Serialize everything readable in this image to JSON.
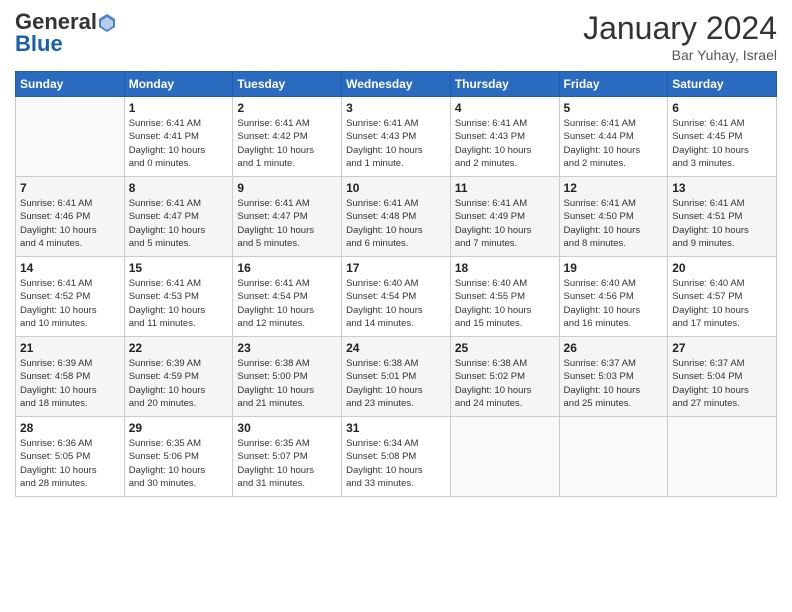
{
  "header": {
    "logo_general": "General",
    "logo_blue": "Blue",
    "month_title": "January 2024",
    "location": "Bar Yuhay, Israel"
  },
  "days_of_week": [
    "Sunday",
    "Monday",
    "Tuesday",
    "Wednesday",
    "Thursday",
    "Friday",
    "Saturday"
  ],
  "weeks": [
    [
      {
        "day": "",
        "info": ""
      },
      {
        "day": "1",
        "info": "Sunrise: 6:41 AM\nSunset: 4:41 PM\nDaylight: 10 hours\nand 0 minutes."
      },
      {
        "day": "2",
        "info": "Sunrise: 6:41 AM\nSunset: 4:42 PM\nDaylight: 10 hours\nand 1 minute."
      },
      {
        "day": "3",
        "info": "Sunrise: 6:41 AM\nSunset: 4:43 PM\nDaylight: 10 hours\nand 1 minute."
      },
      {
        "day": "4",
        "info": "Sunrise: 6:41 AM\nSunset: 4:43 PM\nDaylight: 10 hours\nand 2 minutes."
      },
      {
        "day": "5",
        "info": "Sunrise: 6:41 AM\nSunset: 4:44 PM\nDaylight: 10 hours\nand 2 minutes."
      },
      {
        "day": "6",
        "info": "Sunrise: 6:41 AM\nSunset: 4:45 PM\nDaylight: 10 hours\nand 3 minutes."
      }
    ],
    [
      {
        "day": "7",
        "info": "Sunrise: 6:41 AM\nSunset: 4:46 PM\nDaylight: 10 hours\nand 4 minutes."
      },
      {
        "day": "8",
        "info": "Sunrise: 6:41 AM\nSunset: 4:47 PM\nDaylight: 10 hours\nand 5 minutes."
      },
      {
        "day": "9",
        "info": "Sunrise: 6:41 AM\nSunset: 4:47 PM\nDaylight: 10 hours\nand 5 minutes."
      },
      {
        "day": "10",
        "info": "Sunrise: 6:41 AM\nSunset: 4:48 PM\nDaylight: 10 hours\nand 6 minutes."
      },
      {
        "day": "11",
        "info": "Sunrise: 6:41 AM\nSunset: 4:49 PM\nDaylight: 10 hours\nand 7 minutes."
      },
      {
        "day": "12",
        "info": "Sunrise: 6:41 AM\nSunset: 4:50 PM\nDaylight: 10 hours\nand 8 minutes."
      },
      {
        "day": "13",
        "info": "Sunrise: 6:41 AM\nSunset: 4:51 PM\nDaylight: 10 hours\nand 9 minutes."
      }
    ],
    [
      {
        "day": "14",
        "info": "Sunrise: 6:41 AM\nSunset: 4:52 PM\nDaylight: 10 hours\nand 10 minutes."
      },
      {
        "day": "15",
        "info": "Sunrise: 6:41 AM\nSunset: 4:53 PM\nDaylight: 10 hours\nand 11 minutes."
      },
      {
        "day": "16",
        "info": "Sunrise: 6:41 AM\nSunset: 4:54 PM\nDaylight: 10 hours\nand 12 minutes."
      },
      {
        "day": "17",
        "info": "Sunrise: 6:40 AM\nSunset: 4:54 PM\nDaylight: 10 hours\nand 14 minutes."
      },
      {
        "day": "18",
        "info": "Sunrise: 6:40 AM\nSunset: 4:55 PM\nDaylight: 10 hours\nand 15 minutes."
      },
      {
        "day": "19",
        "info": "Sunrise: 6:40 AM\nSunset: 4:56 PM\nDaylight: 10 hours\nand 16 minutes."
      },
      {
        "day": "20",
        "info": "Sunrise: 6:40 AM\nSunset: 4:57 PM\nDaylight: 10 hours\nand 17 minutes."
      }
    ],
    [
      {
        "day": "21",
        "info": "Sunrise: 6:39 AM\nSunset: 4:58 PM\nDaylight: 10 hours\nand 18 minutes."
      },
      {
        "day": "22",
        "info": "Sunrise: 6:39 AM\nSunset: 4:59 PM\nDaylight: 10 hours\nand 20 minutes."
      },
      {
        "day": "23",
        "info": "Sunrise: 6:38 AM\nSunset: 5:00 PM\nDaylight: 10 hours\nand 21 minutes."
      },
      {
        "day": "24",
        "info": "Sunrise: 6:38 AM\nSunset: 5:01 PM\nDaylight: 10 hours\nand 23 minutes."
      },
      {
        "day": "25",
        "info": "Sunrise: 6:38 AM\nSunset: 5:02 PM\nDaylight: 10 hours\nand 24 minutes."
      },
      {
        "day": "26",
        "info": "Sunrise: 6:37 AM\nSunset: 5:03 PM\nDaylight: 10 hours\nand 25 minutes."
      },
      {
        "day": "27",
        "info": "Sunrise: 6:37 AM\nSunset: 5:04 PM\nDaylight: 10 hours\nand 27 minutes."
      }
    ],
    [
      {
        "day": "28",
        "info": "Sunrise: 6:36 AM\nSunset: 5:05 PM\nDaylight: 10 hours\nand 28 minutes."
      },
      {
        "day": "29",
        "info": "Sunrise: 6:35 AM\nSunset: 5:06 PM\nDaylight: 10 hours\nand 30 minutes."
      },
      {
        "day": "30",
        "info": "Sunrise: 6:35 AM\nSunset: 5:07 PM\nDaylight: 10 hours\nand 31 minutes."
      },
      {
        "day": "31",
        "info": "Sunrise: 6:34 AM\nSunset: 5:08 PM\nDaylight: 10 hours\nand 33 minutes."
      },
      {
        "day": "",
        "info": ""
      },
      {
        "day": "",
        "info": ""
      },
      {
        "day": "",
        "info": ""
      }
    ]
  ]
}
